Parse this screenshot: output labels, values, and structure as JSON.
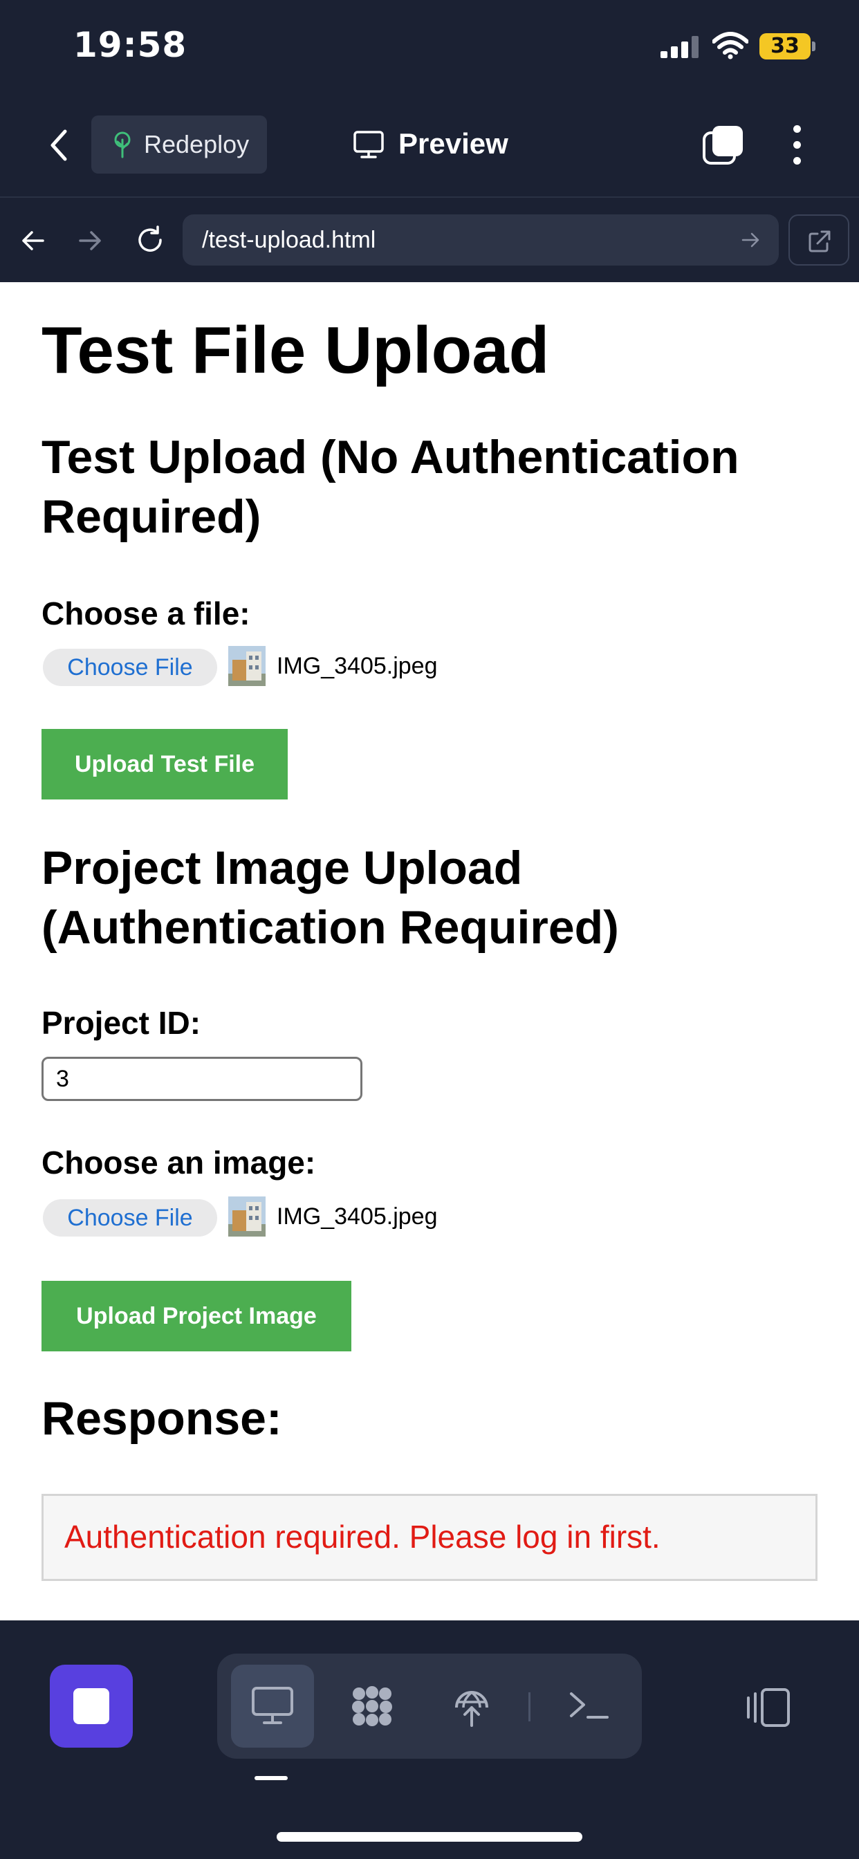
{
  "status_bar": {
    "time": "19:58",
    "battery": "33"
  },
  "header": {
    "redeploy_label": "Redeploy",
    "title": "Preview"
  },
  "browser": {
    "url": "/test-upload.html"
  },
  "page": {
    "title": "Test File Upload",
    "test_section": {
      "heading": "Test Upload (No Authentication Required)",
      "file_label": "Choose a file:",
      "choose_button": "Choose File",
      "file_name": "IMG_3405.jpeg",
      "upload_button": "Upload Test File"
    },
    "project_section": {
      "heading": "Project Image Upload (Authentication Required)",
      "project_id_label": "Project ID:",
      "project_id_value": "3",
      "image_label": "Choose an image:",
      "choose_button": "Choose File",
      "file_name": "IMG_3405.jpeg",
      "upload_button": "Upload Project Image"
    },
    "response": {
      "heading": "Response:",
      "message": "Authentication required. Please log in first."
    }
  },
  "colors": {
    "app_background": "#1b2133",
    "upload_button": "#4cae50",
    "error_text": "#e11b14",
    "stop_button": "#5840df",
    "battery": "#f4c724"
  },
  "icons": {
    "status": [
      "signal-icon",
      "wifi-icon",
      "battery-icon"
    ],
    "header": [
      "back-arrow-icon",
      "tree-icon",
      "monitor-icon",
      "tabs-icon",
      "more-vertical-icon"
    ],
    "browser": [
      "arrow-left-icon",
      "arrow-right-icon",
      "reload-icon",
      "go-arrow-icon",
      "external-link-icon"
    ],
    "toolbar": [
      "stop-icon",
      "monitor-icon",
      "cluster-icon",
      "globe-upload-icon",
      "terminal-icon",
      "panel-icon"
    ]
  }
}
